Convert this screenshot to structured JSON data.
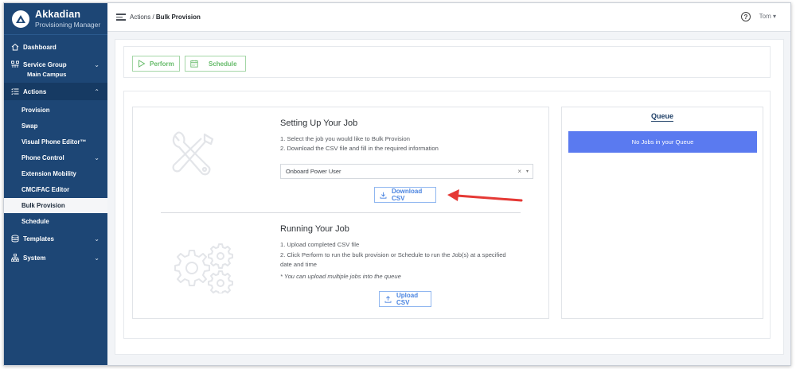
{
  "brand": {
    "name": "Akkadian",
    "subtitle": "Provisioning Manager"
  },
  "sidebar": {
    "dashboard": "Dashboard",
    "service_group": "Service Group",
    "service_group_value": "Main Campus",
    "actions": "Actions",
    "action_items": [
      "Provision",
      "Swap",
      "Visual Phone Editor™",
      "Phone Control",
      "Extension Mobility",
      "CMC/FAC Editor",
      "Bulk Provision",
      "Schedule"
    ],
    "active_item": "Bulk Provision",
    "templates": "Templates",
    "system": "System"
  },
  "header": {
    "breadcrumb_parent": "Actions",
    "breadcrumb_separator": " / ",
    "breadcrumb_current": "Bulk Provision",
    "help": "?",
    "user": "Tom ▾"
  },
  "toolbar": {
    "perform_label": "Perform",
    "schedule_label": "Schedule"
  },
  "setup": {
    "title": "Setting Up Your Job",
    "step1": "1. Select the job you would like to Bulk Provision",
    "step2": "2. Download the CSV file and fill in the required information",
    "job_select_value": "Onboard Power User",
    "clear": "×",
    "dropdown": "▾",
    "download_label": "Download CSV"
  },
  "running": {
    "title": "Running Your Job",
    "step1": "1. Upload completed CSV file",
    "step2_line1": "2. Click Perform to run the bulk provision or Schedule to run the Job(s) at a specified",
    "step2_line2": "date and time",
    "note": "* You can upload multiple jobs into the queue",
    "upload_label": "Upload CSV"
  },
  "queue": {
    "title": "Queue",
    "empty_message": "No Jobs in your Queue"
  },
  "colors": {
    "sidebar": "#1d4675",
    "green": "#66bb6a",
    "blue_button": "#4a84e0",
    "queue_bar": "#5a7af0",
    "arrow": "#e53935"
  }
}
